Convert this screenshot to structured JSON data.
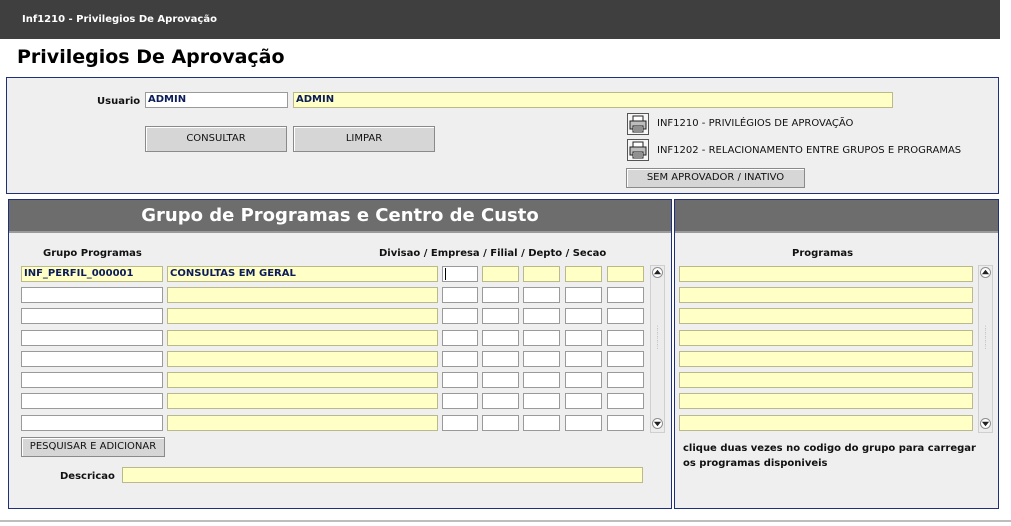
{
  "window": {
    "title": "Inf1210 - Privilegios De Aprovação"
  },
  "page": {
    "title": "Privilegios De Aprovação"
  },
  "filter": {
    "usuario_label": "Usuario",
    "usuario_code": "ADMIN",
    "usuario_name": "ADMIN",
    "consultar_label": "CONSULTAR",
    "limpar_label": "LIMPAR",
    "report1_label": "INF1210 - PRIVILÉGIOS DE APROVAÇÃO",
    "report2_label": "INF1202 - RELACIONAMENTO ENTRE GRUPOS E PROGRAMAS",
    "sem_aprovador_label": "SEM APROVADOR / INATIVO",
    "report_icon": "printer-icon"
  },
  "grupo": {
    "header": "Grupo de Programas e Centro de Custo",
    "col_grupo": "Grupo Programas",
    "col_divisao": "Divisao / Empresa / Filial / Depto / Secao",
    "rows": [
      {
        "code": "INF_PERFIL_000001",
        "desc": "CONSULTAS EM GERAL"
      },
      {
        "code": "",
        "desc": ""
      },
      {
        "code": "",
        "desc": ""
      },
      {
        "code": "",
        "desc": ""
      },
      {
        "code": "",
        "desc": ""
      },
      {
        "code": "",
        "desc": ""
      },
      {
        "code": "",
        "desc": ""
      },
      {
        "code": "",
        "desc": ""
      }
    ],
    "pesquisar_label": "PESQUISAR E ADICIONAR",
    "descricao_label": "Descricao",
    "descricao_value": ""
  },
  "programas": {
    "header": "",
    "col_label": "Programas",
    "rows": [
      "",
      "",
      "",
      "",
      "",
      "",
      "",
      ""
    ],
    "hint": "clique duas vezes no codigo do grupo para carregar os programas disponiveis"
  },
  "colors": {
    "titlebar": "#3f3f3f",
    "panel_border": "#1f2f7a",
    "field_yellow": "#ffffc6",
    "header_gray": "#6d6d6d"
  }
}
